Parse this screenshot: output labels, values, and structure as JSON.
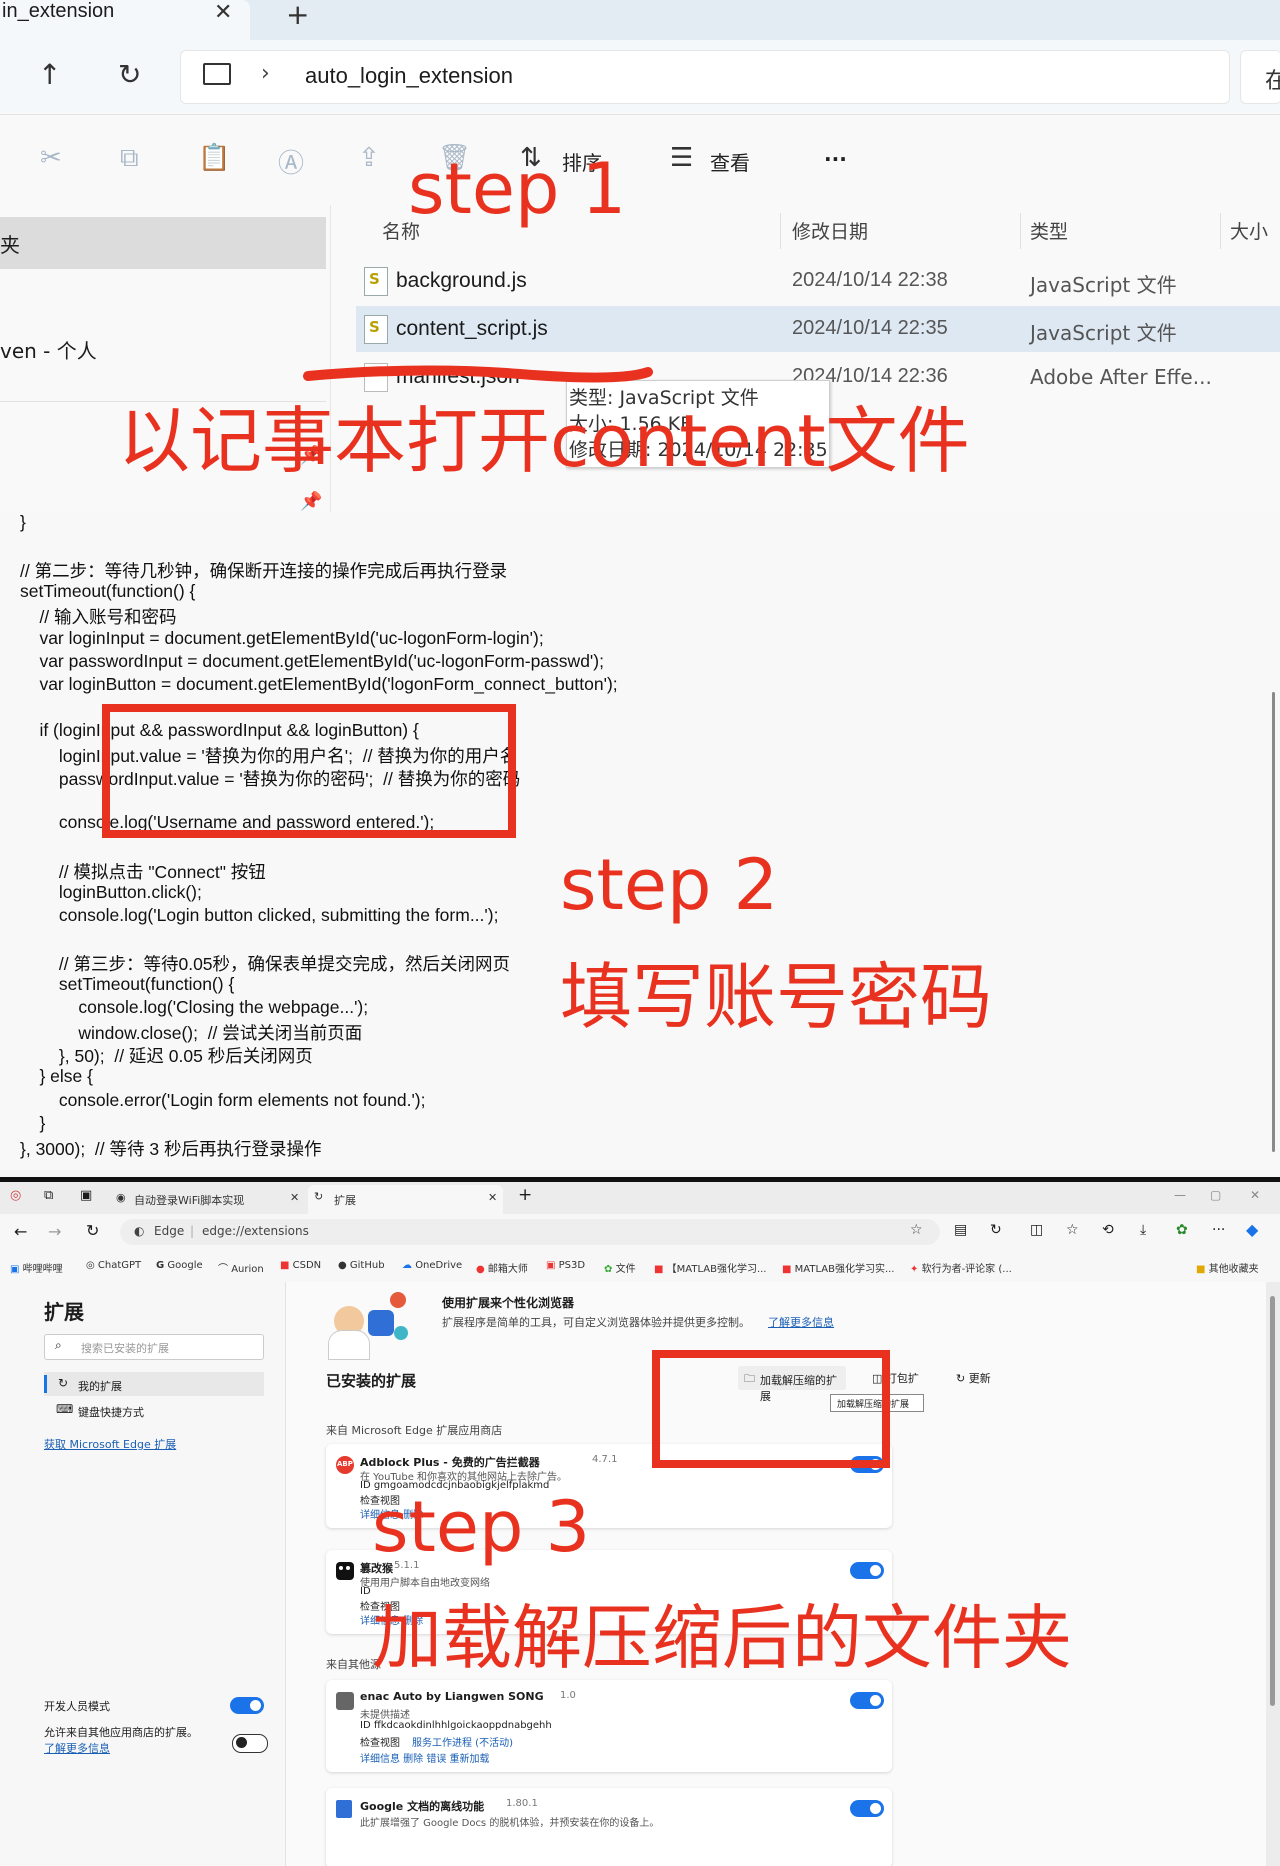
{
  "explorer": {
    "tab_title": "in_extension",
    "close_glyph": "✕",
    "newtab_glyph": "+",
    "up_glyph": "↑",
    "refresh_glyph": "↻",
    "breadcrumb_sep": "›",
    "path": "auto_login_extension",
    "search_glyph": "在",
    "toolbar": {
      "cut_icon": "✂",
      "copy_icon": "⧉",
      "paste_icon": "📋",
      "rename_icon": "Ⓐ",
      "share_icon": "⇪",
      "delete_icon": "🗑",
      "sort_icon": "⇅",
      "sort_label": "排序",
      "view_icon": "☰",
      "view_label": "查看",
      "more_label": "···"
    },
    "sidebar": {
      "selected_label": "夹",
      "onedrive_label": "ven - 个人"
    },
    "columns": {
      "name": "名称",
      "modified": "修改日期",
      "type": "类型",
      "size": "大小"
    },
    "files": [
      {
        "name": "background.js",
        "modified": "2024/10/14 22:38",
        "type": "JavaScript 文件"
      },
      {
        "name": "content_script.js",
        "modified": "2024/10/14 22:35",
        "type": "JavaScript 文件"
      },
      {
        "name": "manifest.json",
        "modified": "2024/10/14 22:36",
        "type": "Adobe After Effe..."
      }
    ],
    "tooltip": {
      "type": "类型: JavaScript 文件",
      "size": "大小: 1.56 KB",
      "modified": "修改日期: 2024/10/14 22:35"
    }
  },
  "code_lines": [
    "}",
    "",
    "// 第二步：等待几秒钟，确保断开连接的操作完成后再执行登录",
    "setTimeout(function() {",
    "    // 输入账号和密码",
    "    var loginInput = document.getElementById('uc-logonForm-login');",
    "    var passwordInput = document.getElementById('uc-logonForm-passwd');",
    "    var loginButton = document.getElementById('logonForm_connect_button');",
    "",
    "    if (loginInput && passwordInput && loginButton) {",
    "        loginInput.value = '替换为你的用户名';  // 替换为你的用户名",
    "        passwordInput.value = '替换为你的密码';  // 替换为你的密码",
    "",
    "        console.log('Username and password entered.');",
    "",
    "        // 模拟点击 \"Connect\" 按钮",
    "        loginButton.click();",
    "        console.log('Login button clicked, submitting the form...');",
    "",
    "        // 第三步：等待0.05秒，确保表单提交完成，然后关闭网页",
    "        setTimeout(function() {",
    "            console.log('Closing the webpage...');",
    "            window.close();  // 尝试关闭当前页面",
    "        }, 50);  // 延迟 0.05 秒后关闭网页",
    "    } else {",
    "        console.error('Login form elements not found.');",
    "    }",
    "}, 3000);  // 等待 3 秒后再执行登录操作"
  ],
  "browser": {
    "tab1": "自动登录WiFi脚本实现",
    "tab2": "扩展",
    "tab_close": "✕",
    "new_tab": "+",
    "addr_brand": "Edge",
    "addr_url": "edge://extensions",
    "window_controls": [
      "—",
      "▢",
      "✕"
    ],
    "favorites": [
      "哔哩哔哩",
      "ChatGPT",
      "Google",
      "Aurion",
      "CSDN",
      "GitHub",
      "OneDrive",
      "邮箱大师",
      "PS3D",
      "文件",
      "【MATLAB强化学习...",
      "MATLAB强化学习实...",
      "软行为者-评论家 (..."
    ],
    "other_favorites": "其他收藏夹",
    "side": {
      "title": "扩展",
      "search_placeholder": "搜索已安装的扩展",
      "my_ext": "我的扩展",
      "shortcuts": "键盘快捷方式",
      "get_link": "获取 Microsoft Edge 扩展",
      "dev_mode": "开发人员模式",
      "allow_other": "允许来自其他应用商店的扩展。",
      "learn_more": "了解更多信息"
    },
    "main": {
      "promo_title": "使用扩展来个性化浏览器",
      "promo_desc": "扩展程序是简单的工具，可自定义浏览器体验并提供更多控制。",
      "promo_link": "了解更多信息",
      "installed_title": "已安装的扩展",
      "load_unpacked": "加载解压缩的扩展",
      "pack": "打包扩",
      "update": "更新",
      "load_tooltip": "加载解压缩的扩展",
      "from_store": "来自 Microsoft Edge 扩展应用商店",
      "from_other": "来自其他源",
      "ext1": {
        "name": "Adblock Plus - 免费的广告拦截器",
        "version": "4.7.1",
        "desc": "在 YouTube 和你喜欢的其他网站上去除广告。",
        "id": "ID gmgoamodcdcjnbaobigkjelfplakmd",
        "inspect": "检查视图",
        "links": "详细信息   删除"
      },
      "ext2": {
        "name": "篡改猴",
        "version": "5.1.1",
        "desc": "使用用户脚本自由地改变网络",
        "id": "ID",
        "inspect": "检查视图",
        "links": "详细信息   删除"
      },
      "ext3": {
        "name": "enac Auto by Liangwen SONG",
        "version": "1.0",
        "desc": "未提供描述",
        "id": "ID ffkdcaokdinlhhlgoickaoppdnabgehh",
        "inspect": "检查视图",
        "inspect_link": "服务工作进程 (不活动)",
        "links": "详细信息   删除   错误   重新加载"
      },
      "ext4": {
        "name": "Google 文档的离线功能",
        "version": "1.80.1",
        "desc": "此扩展增强了 Google Docs 的脱机体验，并预安装在你的设备上。"
      }
    }
  },
  "annotations": {
    "step1": "step 1",
    "open_note": "以记事本打开content文件",
    "step2": "step 2",
    "fill": "填写账号密码",
    "step3": "step 3",
    "load": "加载解压缩后的文件夹"
  }
}
